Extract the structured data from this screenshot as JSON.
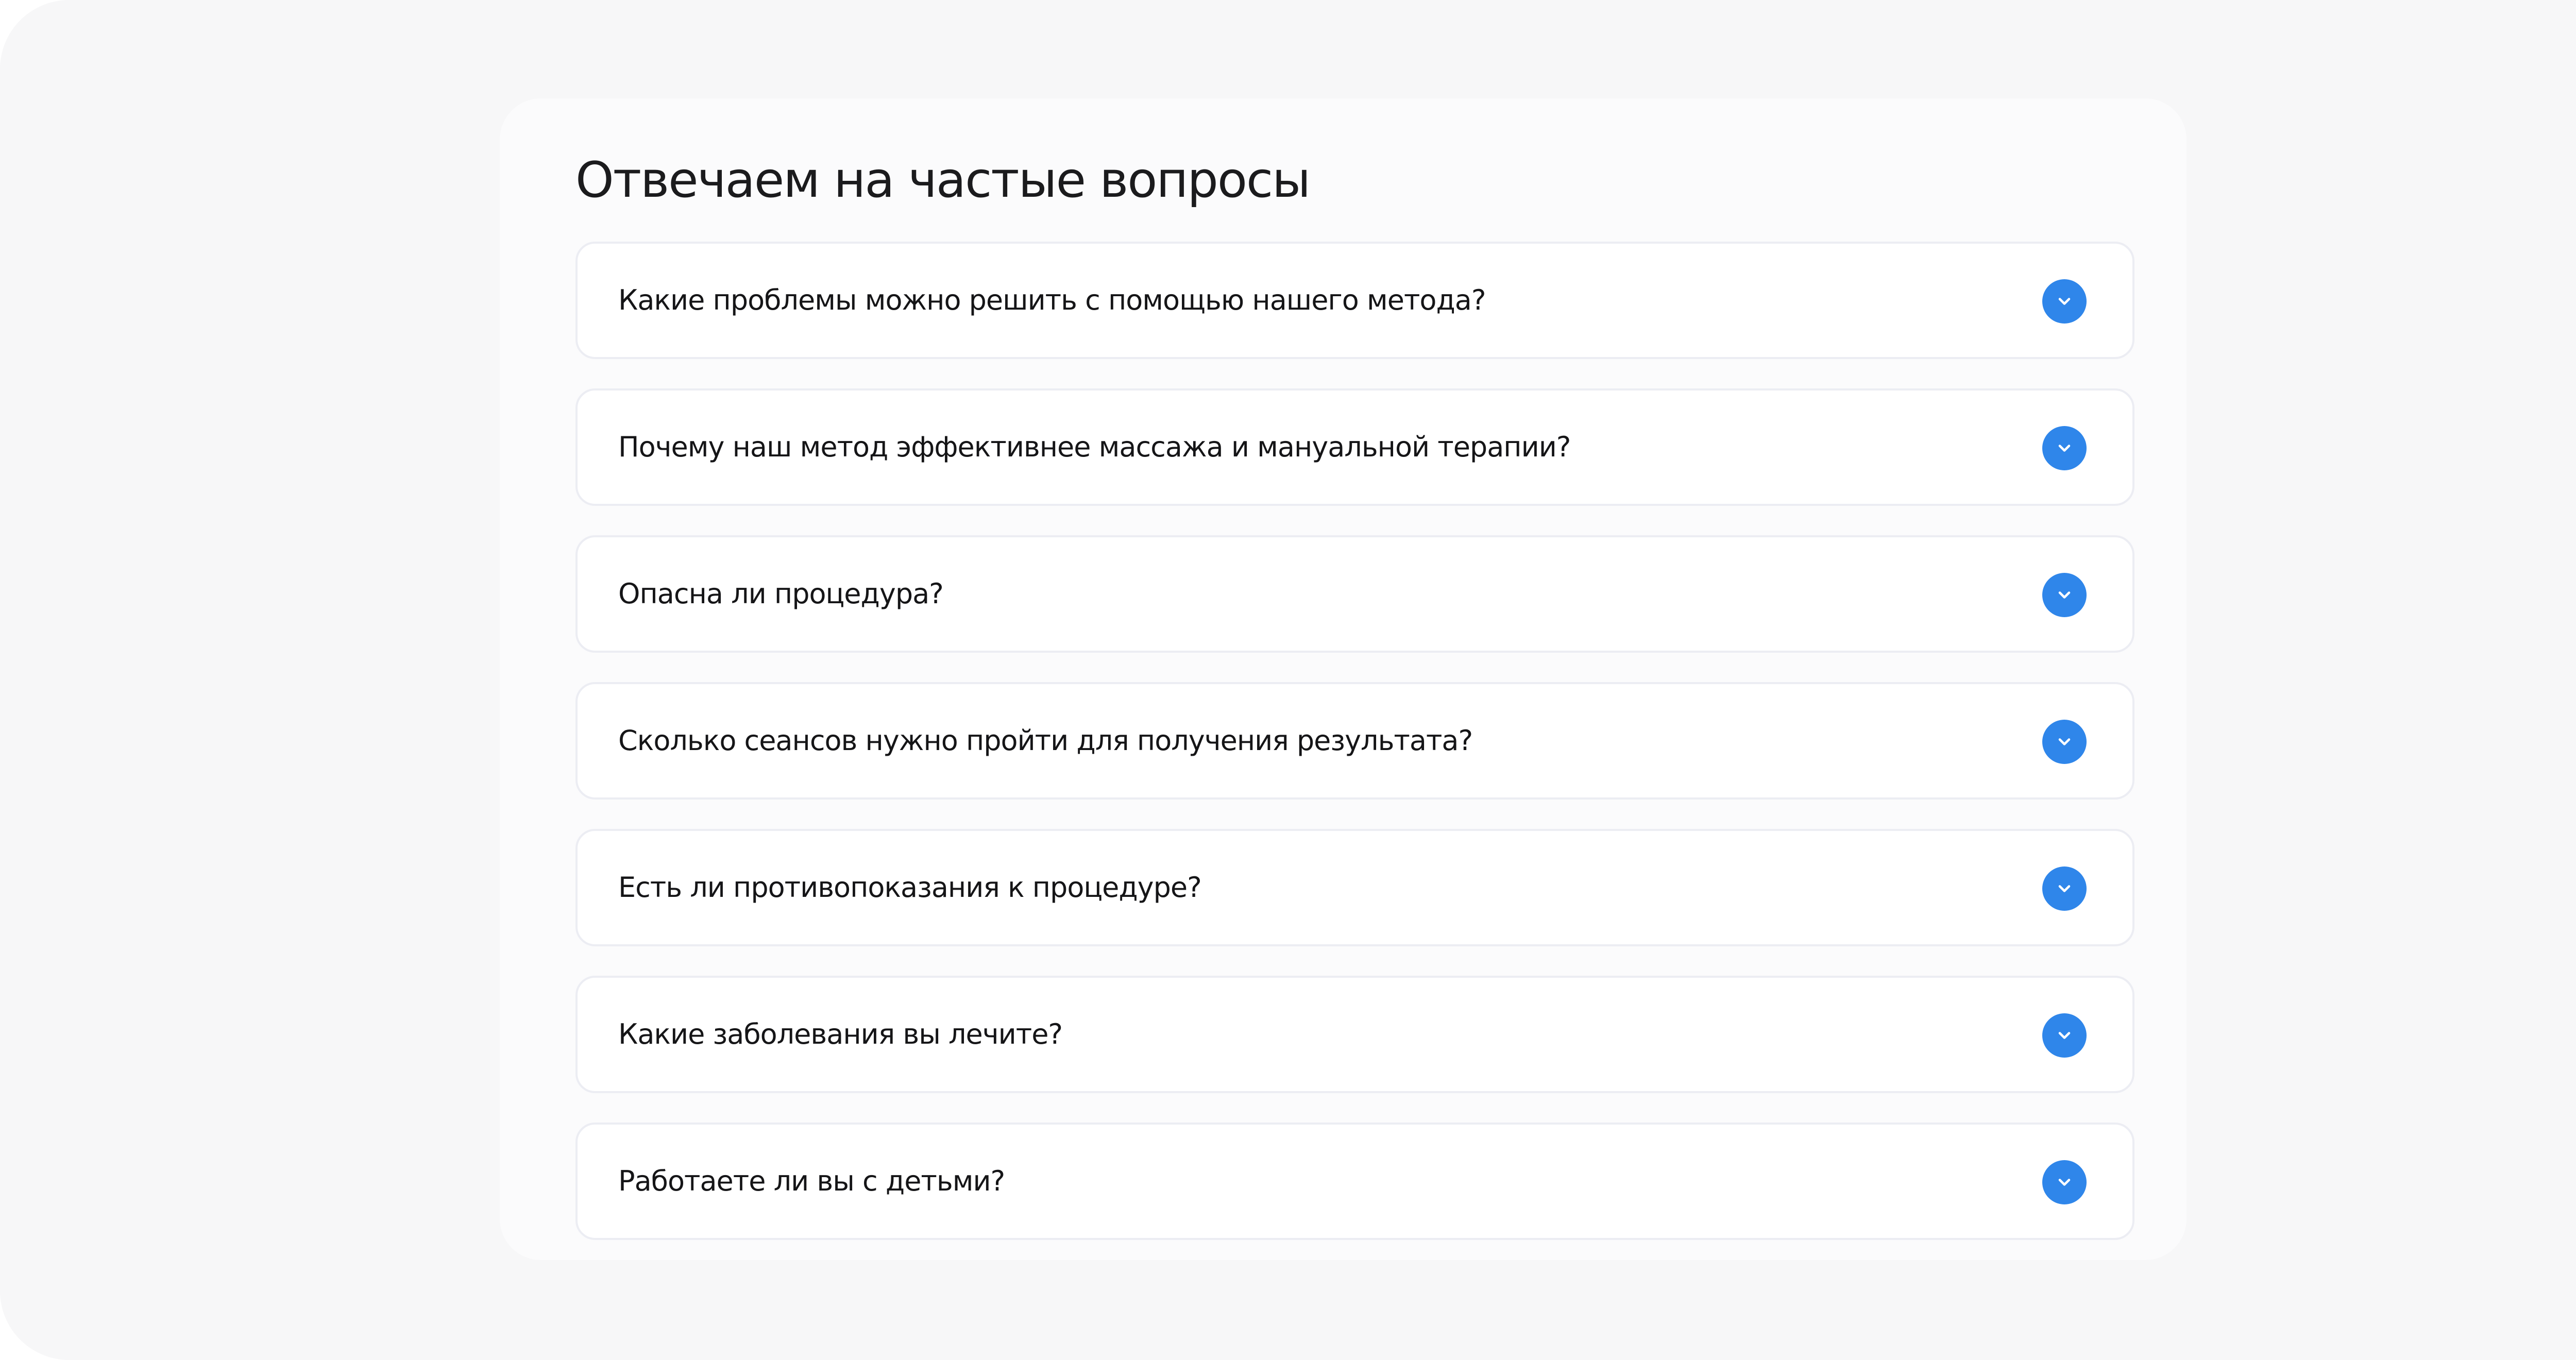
{
  "faq": {
    "title": "Отвечаем на частые вопросы",
    "items": [
      {
        "question": "Какие проблемы можно решить с помощью нашего метода?",
        "icon": "chevron-down-icon"
      },
      {
        "question": "Почему наш метод эффективнее массажа и мануальной терапии?",
        "icon": "chevron-down-icon"
      },
      {
        "question": "Опасна ли процедура?",
        "icon": "chevron-down-icon"
      },
      {
        "question": "Сколько сеансов нужно пройти для получения результата?",
        "icon": "chevron-down-icon"
      },
      {
        "question": "Есть ли противопоказания к процедуре?",
        "icon": "chevron-down-icon"
      },
      {
        "question": "Какие заболевания вы лечите?",
        "icon": "chevron-down-icon"
      },
      {
        "question": "Работаете ли вы с детьми?",
        "icon": "chevron-down-icon"
      }
    ]
  },
  "colors": {
    "page_background": "#f7f7f8",
    "card_background": "#fbfbfc",
    "item_background": "#ffffff",
    "item_border": "#ecedf3",
    "accent": "#2f86ea",
    "text": "#151517"
  }
}
